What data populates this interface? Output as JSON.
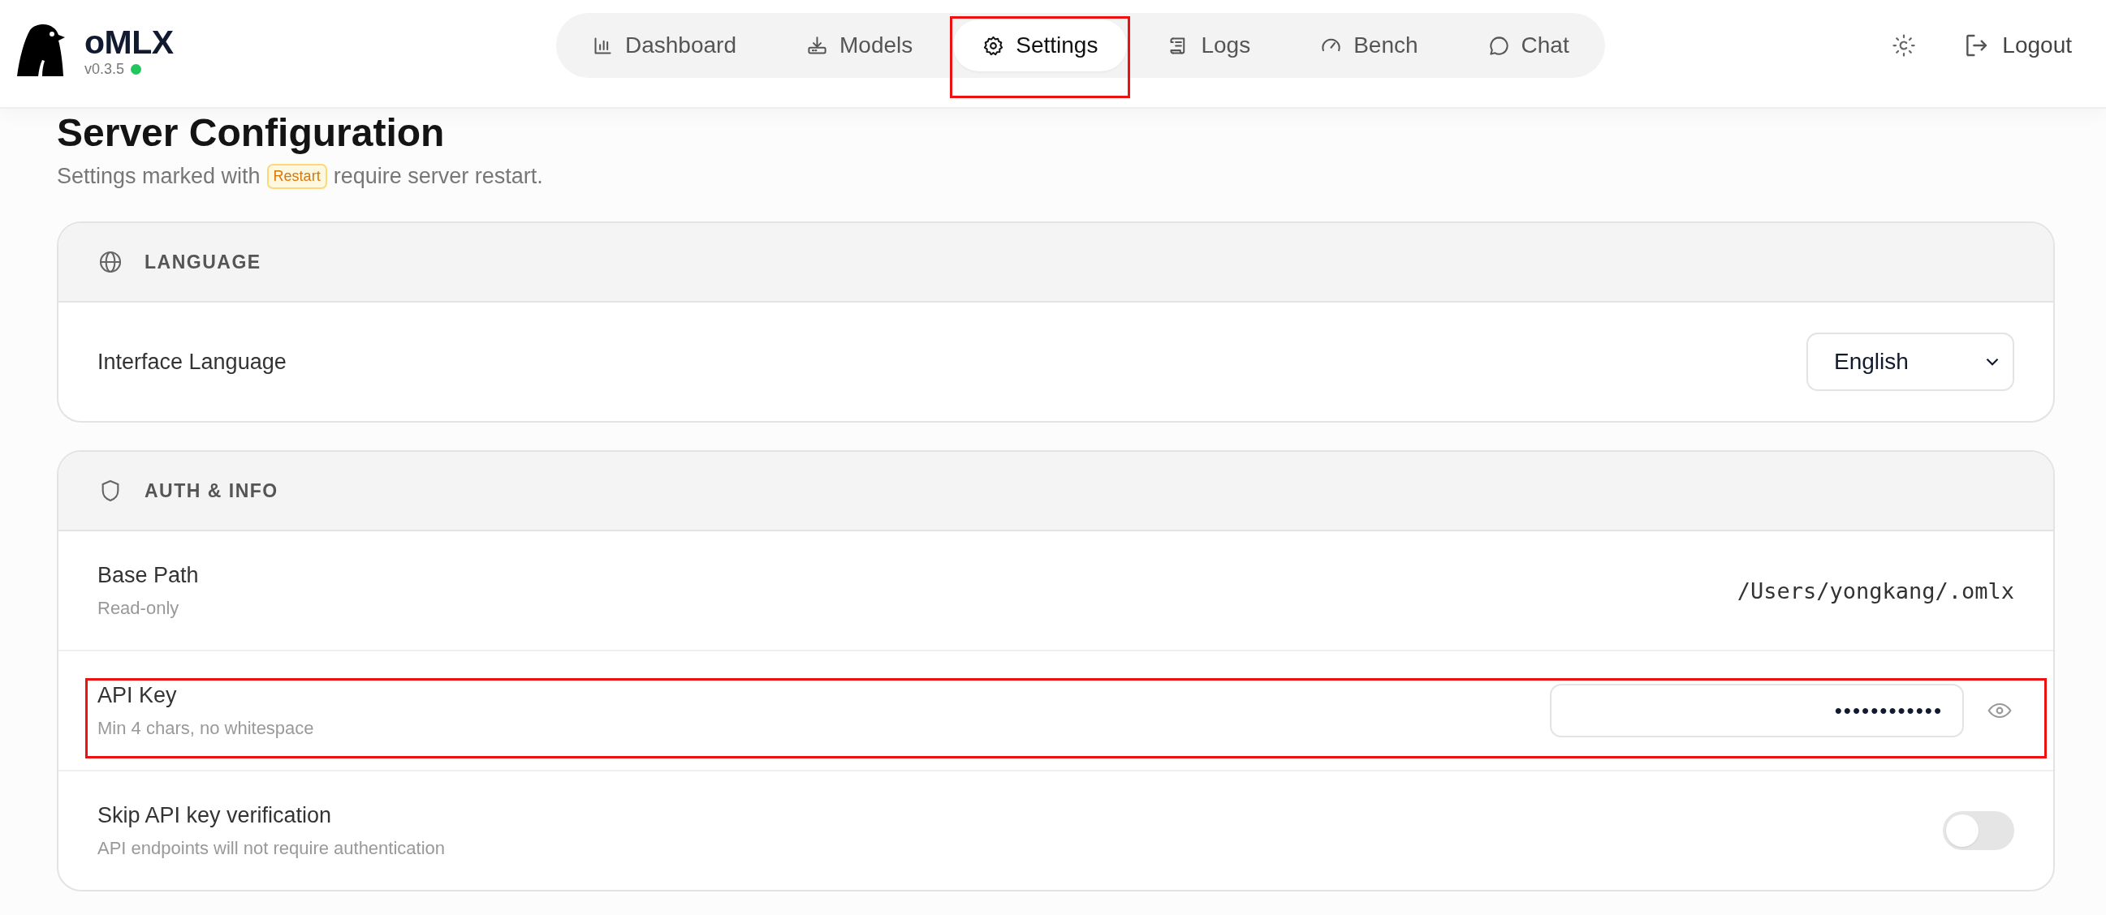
{
  "app": {
    "name": "oMLX",
    "version": "v0.3.5",
    "online": true
  },
  "nav": [
    {
      "label": "Dashboard",
      "selected": false,
      "highlighted": false
    },
    {
      "label": "Models",
      "selected": false,
      "highlighted": false
    },
    {
      "label": "Settings",
      "selected": true,
      "highlighted": true
    },
    {
      "label": "Logs",
      "selected": false,
      "highlighted": false
    },
    {
      "label": "Bench",
      "selected": false,
      "highlighted": false
    },
    {
      "label": "Chat",
      "selected": false,
      "highlighted": false
    }
  ],
  "logout": "Logout",
  "page": {
    "title": "Server Configuration",
    "subtitle_before": "Settings marked with",
    "badge": "Restart",
    "subtitle_after": "require server restart."
  },
  "sections": [
    {
      "title": "LANGUAGE",
      "rows": [
        {
          "kind": "select",
          "label": "Interface Language",
          "value": "English"
        }
      ]
    },
    {
      "title": "AUTH & INFO",
      "rows": [
        {
          "kind": "text",
          "label": "Base Path",
          "hint": "Read-only",
          "value": "/Users/yongkang/.omlx"
        },
        {
          "kind": "password",
          "label": "API Key",
          "hint": "Min 4 chars, no whitespace",
          "value": "••••••••••••",
          "highlighted": true
        },
        {
          "kind": "toggle",
          "label": "Skip API key verification",
          "hint": "API endpoints will not require authentication",
          "on": false
        }
      ]
    }
  ]
}
